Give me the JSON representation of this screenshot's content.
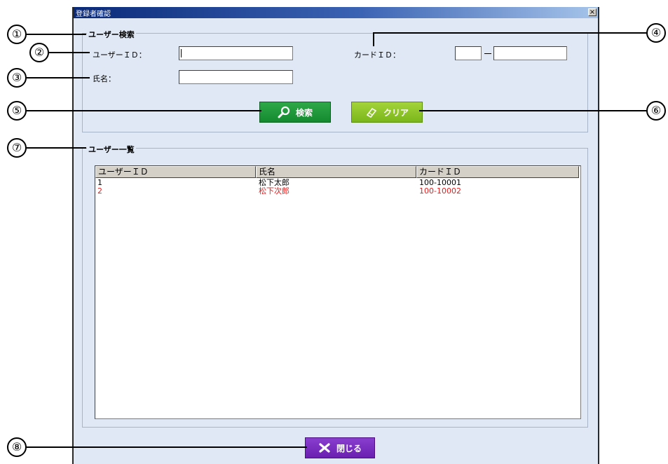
{
  "window": {
    "title": "登録者確認",
    "close_glyph": "×"
  },
  "search_group": {
    "title": "ユーザー検索",
    "user_id_label": "ユーザーＩＤ：",
    "user_id_value": "",
    "name_label": "氏名：",
    "name_value": "",
    "card_id_label": "カードＩＤ：",
    "card_id_part1": "",
    "card_id_part2": ""
  },
  "buttons": {
    "search_label": "検索",
    "clear_label": "クリア",
    "close_label": "閉じる",
    "search_icon": "search-icon",
    "clear_icon": "eraser-icon",
    "close_icon": "close-x-icon"
  },
  "list_group": {
    "title": "ユーザー一覧",
    "columns": [
      "ユーザーＩＤ",
      "氏名",
      "カードＩＤ"
    ],
    "rows": [
      {
        "user_id": "1",
        "name": "松下太郎",
        "card_id": "100-10001",
        "color": "#000000"
      },
      {
        "user_id": "2",
        "name": "松下次郎",
        "card_id": "100-10002",
        "color": "#e02020"
      }
    ]
  },
  "callouts": [
    "①",
    "②",
    "③",
    "④",
    "⑤",
    "⑥",
    "⑦",
    "⑧"
  ],
  "colors": {
    "window_bg": "#dfe8f4",
    "search_button": "#1f9a3a",
    "clear_button": "#8cc42a",
    "close_button": "#7a2ec0",
    "row_highlight_text": "#e02020"
  }
}
